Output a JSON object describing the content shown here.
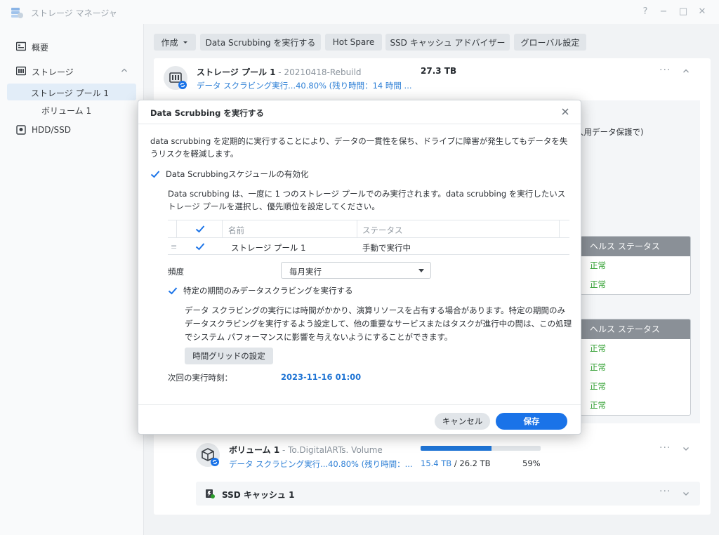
{
  "window": {
    "title": "ストレージ マネージャ",
    "controls": [
      "?",
      "−",
      "□",
      "✕"
    ]
  },
  "sidebar": {
    "items": [
      {
        "label": "概要",
        "icon": "overview-icon"
      },
      {
        "label": "ストレージ",
        "icon": "storage-icon"
      },
      {
        "label": "ストレージ プール 1",
        "active": true
      },
      {
        "label": "ボリューム 1"
      },
      {
        "label": "HDD/SSD",
        "icon": "hdd-icon"
      }
    ]
  },
  "toolbar": {
    "create": "作成",
    "scrub": "Data Scrubbing を実行する",
    "hot_spare": "Hot Spare",
    "ssd_advisor": "SSD キャッシュ アドバイザー",
    "global": "グローバル設定"
  },
  "pool": {
    "title": "ストレージ プール 1",
    "subtitle": " - 20210418-Rebuild",
    "size": "27.3 TB",
    "status": "データ スクラビング実行...40.80% (残り時間：14 時間 ..."
  },
  "background": {
    "partial_text": "久用データ保護で)",
    "health_tables": [
      {
        "header": "ヘルス ステータス",
        "cells": [
          "正常",
          "正常"
        ]
      },
      {
        "header": "ヘルス ステータス",
        "cells": [
          "正常",
          "正常",
          "正常",
          "正常"
        ]
      }
    ]
  },
  "volume": {
    "title": "ボリューム 1",
    "subtitle": " - To.DigitalARTs. Volume",
    "status": "データ スクラビング実行...40.80% (残り時間：...",
    "used": "15.4 TB",
    "total_text": " / 26.2 TB",
    "percent": "59%",
    "fill_fraction": 0.59
  },
  "ssd_cache": {
    "title": "SSD キャッシュ 1"
  },
  "modal": {
    "title": "Data Scrubbing を実行する",
    "description": "data scrubbing を定期的に実行することにより、データの一貫性を保ち、ドライブに障害が発生してもデータを失うリスクを軽減します。",
    "enable_schedule": "Data Scrubbingスケジュールの有効化",
    "schedule_desc": "Data scrubbing は、一度に 1 つのストレージ プールでのみ実行されます。data scrubbing を実行したいストレージ プールを選択し、優先順位を設定してください。",
    "table": {
      "headers": {
        "name": "名前",
        "status": "ステータス"
      },
      "rows": [
        {
          "name": "ストレージ プール 1",
          "status": "手動で実行中",
          "checked": true
        }
      ]
    },
    "frequency_label": "頻度",
    "frequency_value": "毎月実行",
    "period_only": "特定の期間のみデータスクラビングを実行する",
    "period_desc": "データ スクラビングの実行には時間がかかり、演算リソースを占有する場合があります。特定の期間のみデータスクラビングを実行するよう設定して、他の重要なサービスまたはタスクが進行中の間は、この処理でシステム パフォーマンスに影響を与えないようにすることができます。",
    "grid_button": "時間グリッドの設定",
    "next_run_label": "次回の実行時刻：",
    "next_run_value": "2023-11-16 01:00",
    "cancel": "キャンセル",
    "save": "保存"
  },
  "colors": {
    "accent": "#1a73e8",
    "link_blue": "#2f80d6",
    "health_green": "#2c9e2c",
    "header_grey": "#8a9097"
  }
}
